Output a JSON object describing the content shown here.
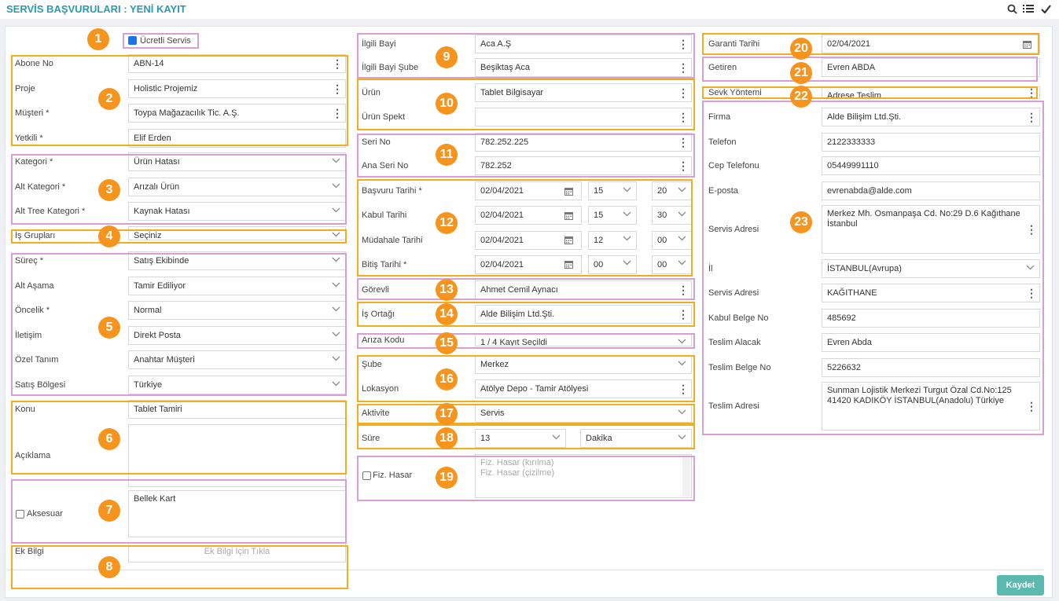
{
  "title": "SERVİS BAŞVURULARI : YENİ KAYIT",
  "save": "Kaydet",
  "b": [
    "1",
    "2",
    "3",
    "4",
    "5",
    "6",
    "7",
    "8",
    "9",
    "10",
    "11",
    "12",
    "13",
    "14",
    "15",
    "16",
    "17",
    "18",
    "19",
    "20",
    "21",
    "22",
    "23"
  ],
  "c1": {
    "ucretli": "Ücretli Servis",
    "abone_l": "Abone No",
    "abone": "ABN-14",
    "proje_l": "Proje",
    "proje": "Holistic Projemiz",
    "musteri_l": "Müşteri *",
    "musteri": "Toypa Mağazacılık Tic. A.Ş.",
    "yetkili_l": "Yetkili *",
    "yetkili": "Elif Erden",
    "kat_l": "Kategori *",
    "kat": "Ürün Hatası",
    "altkat_l": "Alt Kategori *",
    "altkat": "Arızalı Ürün",
    "tree_l": "Alt Tree Kategori *",
    "tree": "Kaynak Hatası",
    "is_l": "İş Grupları",
    "is": "Seçiniz",
    "surec_l": "Süreç *",
    "surec": "Satış Ekibinde",
    "asama_l": "Alt Aşama",
    "asama": "Tamir Ediliyor",
    "oncelik_l": "Öncelik *",
    "oncelik": "Normal",
    "iletisim_l": "İletişim",
    "iletisim": "Direkt Posta",
    "ozel_l": "Özel Tanım",
    "ozel": "Anahtar Müşteri",
    "bolge_l": "Satış Bölgesi",
    "bolge": "Türkiye",
    "konu_l": "Konu",
    "konu": "Tablet Tamiri",
    "aciklama_l": "Açıklama",
    "aksesuar_l": "Aksesuar",
    "aksesuar": "Bellek Kart",
    "ek_l": "Ek Bilgi",
    "ek_ph": "Ek Bilgi İçin Tıkla"
  },
  "c2": {
    "bayi_l": "İlgili Bayi",
    "bayi": "Aca A.Ş",
    "sube_l": "İlgili Bayi Şube",
    "sube": "Beşiktaş Aca",
    "urun_l": "Ürün",
    "urun": "Tablet Bilgisayar",
    "spekt_l": "Ürün Spekt",
    "seri_l": "Seri No",
    "seri": "782.252.225",
    "anaseri_l": "Ana Seri No",
    "anaseri": "782.252",
    "dates": [
      {
        "l": "Başvuru Tarihi *",
        "d": "02/04/2021",
        "h": "15",
        "m": "20"
      },
      {
        "l": "Kabul Tarihi",
        "d": "02/04/2021",
        "h": "15",
        "m": "30"
      },
      {
        "l": "Müdahale Tarihi",
        "d": "02/04/2021",
        "h": "12",
        "m": "00"
      },
      {
        "l": "Bitiş Tarihi *",
        "d": "02/04/2021",
        "h": "00",
        "m": "00"
      }
    ],
    "gorevli_l": "Görevli",
    "gorevli": "Ahmet Cemil Aynacı",
    "ortak_l": "İş Ortağı",
    "ortak": "Alde Bilişim Ltd.Şti.",
    "ariza_l": "Arıza Kodu",
    "ariza": "1 / 4 Kayıt Seçildi",
    "sube2_l": "Şube",
    "sube2": "Merkez",
    "lok_l": "Lokasyon",
    "lok": "Atölye Depo - Tamir Atölyesi",
    "akt_l": "Aktivite",
    "akt": "Servis",
    "sure_l": "Süre",
    "sure": "13",
    "birim": "Dakika",
    "fiz_l": "Fiz. Hasar",
    "fiz_ph": "Fiz. Hasar (kırılma)\nFiz. Hasar (çizilme)"
  },
  "c3": {
    "garanti_l": "Garanti Tarihi",
    "garanti": "02/04/2021",
    "getiren_l": "Getiren",
    "getiren": "Evren ABDA",
    "sevk_l": "Sevk Yöntemi",
    "sevk": "Adrese Teslim",
    "firma_l": "Firma",
    "firma": "Alde Bilişim Ltd.Şti.",
    "tel_l": "Telefon",
    "tel": "2122333333",
    "cep_l": "Cep Telefonu",
    "cep": "05449991110",
    "mail_l": "E-posta",
    "mail": "evrenabda@alde.com",
    "adres_l": "Servis Adresi",
    "adres": "Merkez Mh. Osmanpaşa Cd. No:29 D.6 Kağıthane İstanbul",
    "il_l": "İl",
    "il": "İSTANBUL(Avrupa)",
    "ilce_l": "Servis Adresi",
    "ilce": "KAĞITHANE",
    "kabul_l": "Kabul Belge No",
    "kabul": "485692",
    "alacak_l": "Teslim Alacak",
    "alacak": "Evren Abda",
    "tbelge_l": "Teslim Belge No",
    "tbelge": "5226632",
    "tadres_l": "Teslim Adresi",
    "tadres": "Sunman Lojistik Merkezi Turgut Özal Cd.No:125\n41420 KADIKÖY İSTANBUL(Anadolu) Türkiye"
  }
}
